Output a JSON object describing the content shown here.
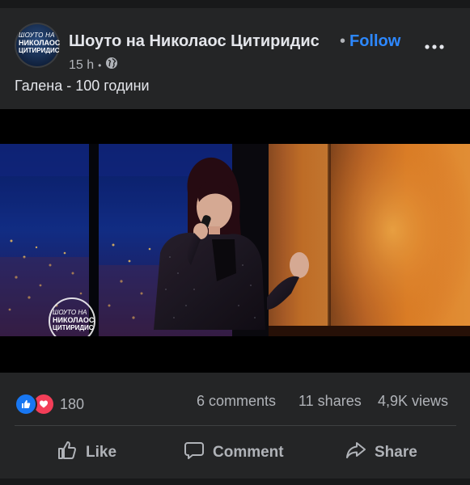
{
  "post": {
    "page_name": "Шоуто на Николаос Цитиридис",
    "separator": "•",
    "follow_label": "Follow",
    "time": "15 h",
    "audience_icon": "globe-icon",
    "text": "Галена - 100 години",
    "avatar_logo": [
      "ШОУТО НА",
      "НИКОЛАОС",
      "ЦИТИРИДИС"
    ]
  },
  "video": {
    "watermark": [
      "ШОУТО НА",
      "НИКОЛАОС",
      "ЦИТИРИДИС"
    ]
  },
  "stats": {
    "reactions_count": "180",
    "reaction_icons": [
      "like-icon",
      "love-icon"
    ],
    "comments": "6 comments",
    "shares": "11 shares",
    "views": "4,9K views"
  },
  "actions": {
    "like_label": "Like",
    "comment_label": "Comment",
    "share_label": "Share"
  },
  "colors": {
    "background": "#18191a",
    "card": "#242526",
    "link_blue": "#2d88ff",
    "like_blue": "#1877f2",
    "love_red": "#f33e58"
  }
}
